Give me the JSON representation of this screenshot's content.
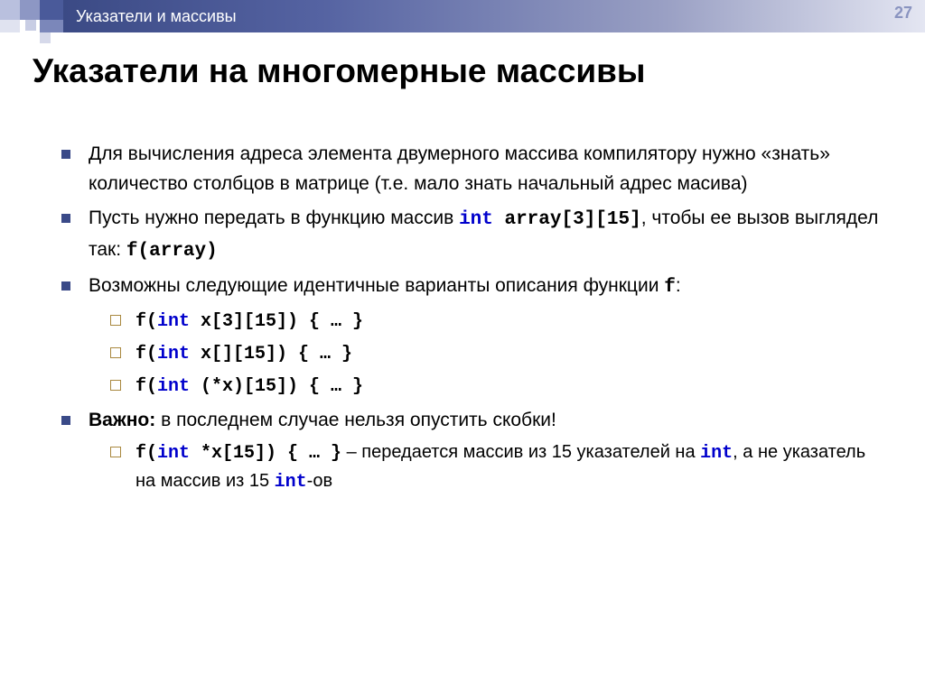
{
  "header": {
    "topic": "Указатели и массивы",
    "page_number": "27"
  },
  "title": "Указатели на многомерные массивы",
  "bullets": {
    "b1": "Для вычисления адреса элемента двумерного массива компилятору нужно «знать» количество столбцов в матрице (т.е. мало знать начальный адрес масива)",
    "b2_a": "Пусть нужно передать в функцию массив ",
    "b2_kw1": "int",
    "b2_code1": " array[3][15]",
    "b2_b": ", чтобы ее вызов выглядел так: ",
    "b2_code2": "f(array)",
    "b3_a": "Возможны следующие идентичные  варианты описания функции ",
    "b3_code1": "f",
    "b3_b": ":",
    "b3_s1_a": "f(",
    "b3_s1_kw": "int",
    "b3_s1_b": " x[3][15]) { … }",
    "b3_s2_a": "f(",
    "b3_s2_kw": "int",
    "b3_s2_b": " x[][15]) { … }",
    "b3_s3_a": "f(",
    "b3_s3_kw": "int",
    "b3_s3_b": " (*x)[15]) { … }",
    "b4_bold": "Важно:",
    "b4_a": " в последнем случае нельзя опустить скобки!",
    "b4_s1_a": "f(",
    "b4_s1_kw": "int",
    "b4_s1_b": " *x[15]) { … }",
    "b4_s1_t1": " – передается массив из 15 указателей на ",
    "b4_s1_kw2": "int",
    "b4_s1_t2": ", а не указатель на массив из 15 ",
    "b4_s1_kw3": "int",
    "b4_s1_t3": "-ов"
  }
}
